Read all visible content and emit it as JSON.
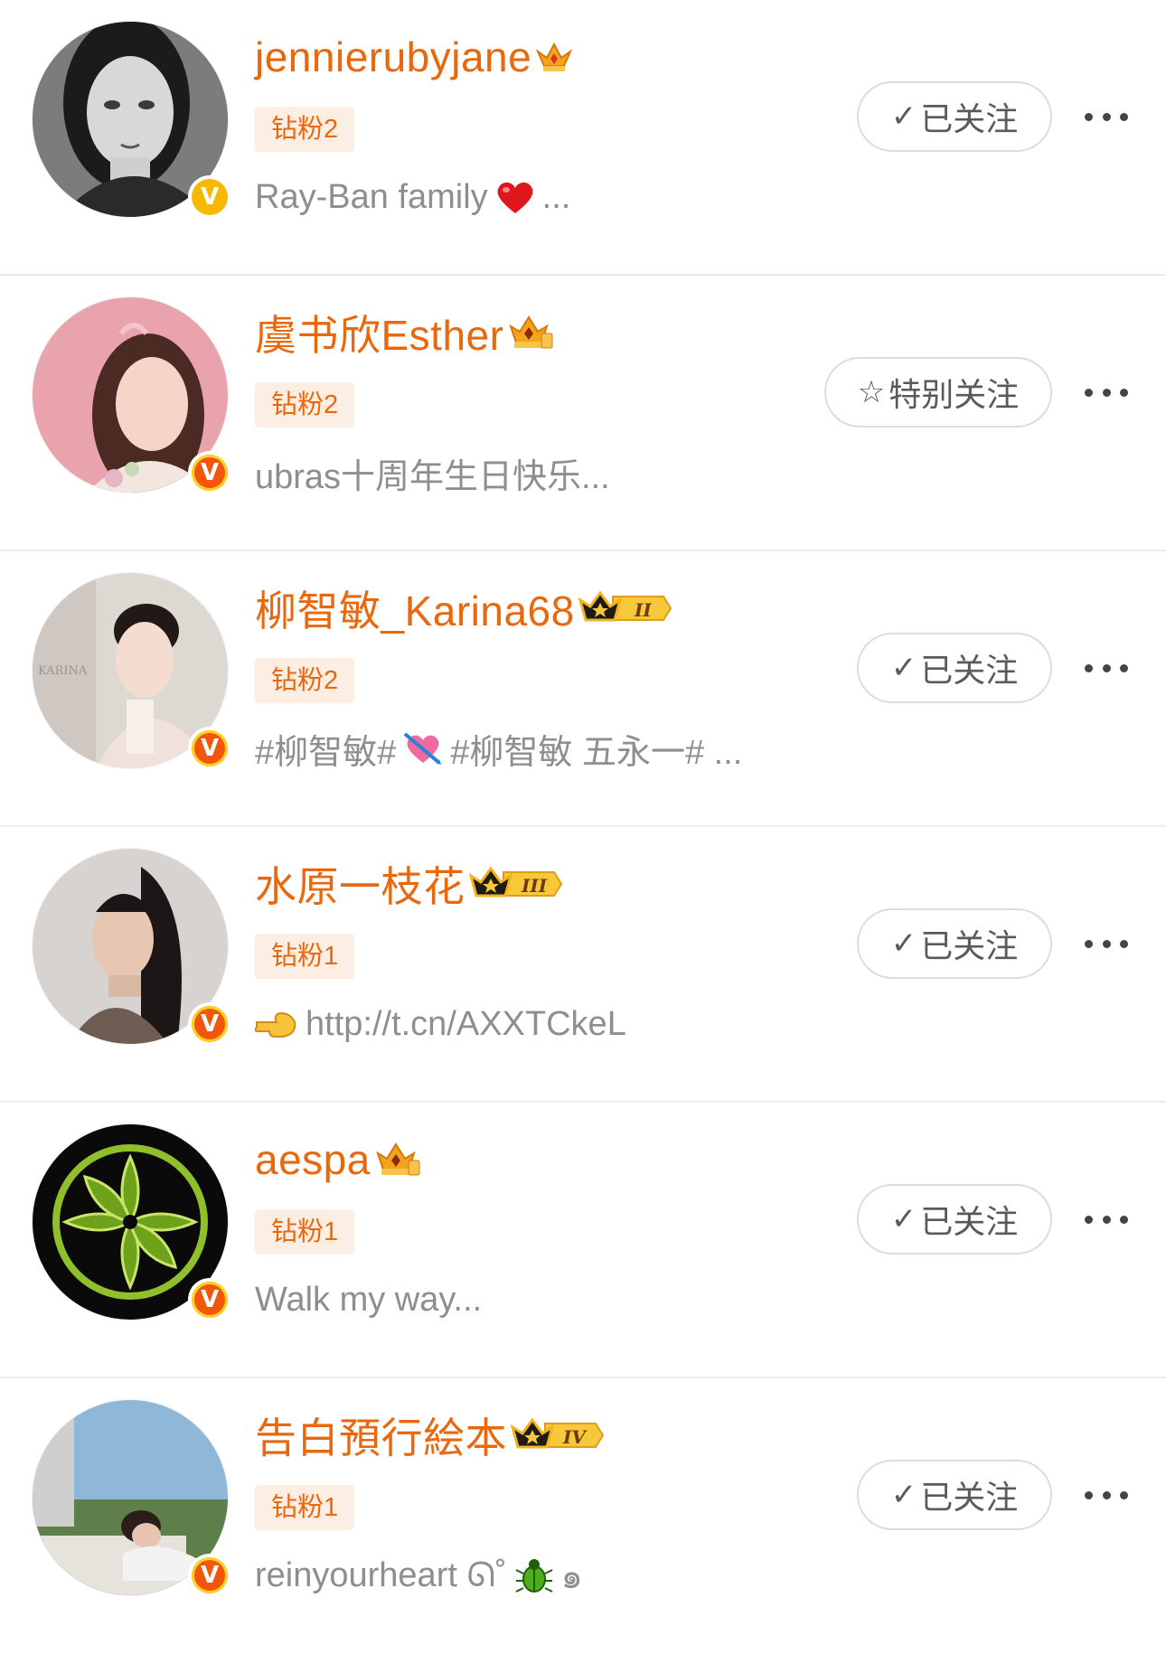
{
  "colors": {
    "name": "#e9680e",
    "tag_bg": "#fdeee4",
    "bio": "#8e8e8e",
    "button_border": "#dcdcdc"
  },
  "users": [
    {
      "name": "jennierubyjane",
      "crown": "crown-gem-icon",
      "badge_level": "",
      "tag": "钻粉2",
      "bio": "Ray-Ban family",
      "bio_emoji": "red-heart-icon",
      "bio_tail": "...",
      "verified": "gold",
      "button_icon": "✓",
      "button_label": "已关注"
    },
    {
      "name": "虞书欣Esther",
      "crown": "crown-gem-icon",
      "badge_level": "",
      "tag": "钻粉2",
      "bio": "ubras十周年生日快乐...",
      "verified": "orange",
      "button_icon": "☆",
      "button_label": "特别关注"
    },
    {
      "name": "柳智敏_Karina68",
      "crown": "crown-level-icon",
      "badge_level": "II",
      "tag": "钻粉2",
      "bio": "#柳智敏#",
      "bio_emoji": "heart-arrow-icon",
      "bio_tail": "#柳智敏 五永一# ...",
      "verified": "orange",
      "button_icon": "✓",
      "button_label": "已关注"
    },
    {
      "name": "水原一枝花",
      "crown": "crown-level-icon",
      "badge_level": "III",
      "tag": "钻粉1",
      "bio_emoji": "pointing-hand-icon",
      "bio": "http://t.cn/AXXTCkeL",
      "verified": "orange",
      "button_icon": "✓",
      "button_label": "已关注"
    },
    {
      "name": "aespa",
      "crown": "crown-gem-icon",
      "badge_level": "",
      "tag": "钻粉1",
      "bio": "Walk my way...",
      "verified": "orange",
      "button_icon": "✓",
      "button_label": "已关注"
    },
    {
      "name": "告白預行絵本",
      "crown": "crown-level-icon",
      "badge_level": "IV",
      "tag": "钻粉1",
      "bio": "reinyourheart ᘏ˚",
      "bio_emoji": "beetle-icon",
      "bio_tail": "๑",
      "verified": "orange",
      "button_icon": "✓",
      "button_label": "已关注"
    }
  ]
}
